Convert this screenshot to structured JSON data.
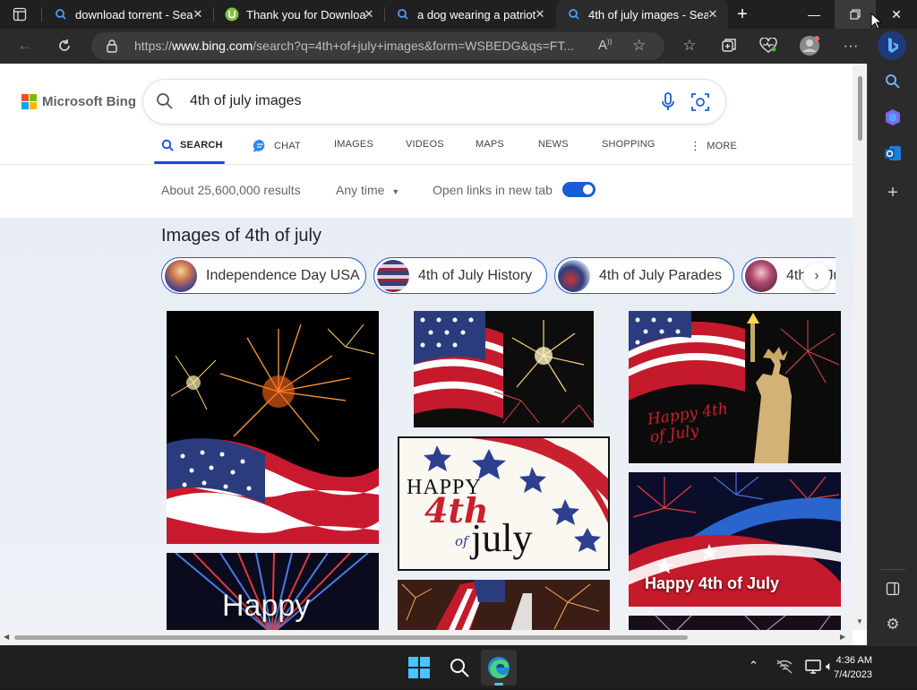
{
  "browser": {
    "tabs": [
      {
        "title": "download torrent - Sea",
        "active": false,
        "icon": "bing-search-icon"
      },
      {
        "title": "Thank you for Download",
        "active": false,
        "icon": "utorrent-icon"
      },
      {
        "title": "a dog wearing a patriot",
        "active": false,
        "icon": "bing-search-icon"
      },
      {
        "title": "4th of july images - Sea",
        "active": true,
        "icon": "bing-search-icon"
      }
    ],
    "url_prefix": "https://",
    "url_domain": "www.bing.com",
    "url_rest": "/search?q=4th+of+july+images&form=WSBEDG&qs=FT..."
  },
  "bing": {
    "logo_text": "Microsoft Bing",
    "query": "4th of july images",
    "nav": {
      "search": "SEARCH",
      "chat": "CHAT",
      "images": "IMAGES",
      "videos": "VIDEOS",
      "maps": "MAPS",
      "news": "NEWS",
      "shopping": "SHOPPING",
      "more": "MORE"
    },
    "results_count": "About 25,600,000 results",
    "any_time": "Any time",
    "open_links": "Open links in new tab",
    "open_links_enabled": true,
    "images_heading": "Images of 4th of july",
    "chips": [
      "Independence Day USA",
      "4th of July History",
      "4th of July Parades",
      "4th of Ju"
    ],
    "tiles": {
      "happy_text": "Happy",
      "card_happy": "HAPPY",
      "card_4th": "4th",
      "card_of": "of",
      "card_july": "july",
      "liberty_script": "Happy 4th of July",
      "globe_label": "Happy 4th of July"
    }
  },
  "taskbar": {
    "time": "4:36 AM",
    "date": "7/4/2023"
  },
  "colors": {
    "accent": "#174ae4",
    "toggle": "#1a5cd6"
  }
}
